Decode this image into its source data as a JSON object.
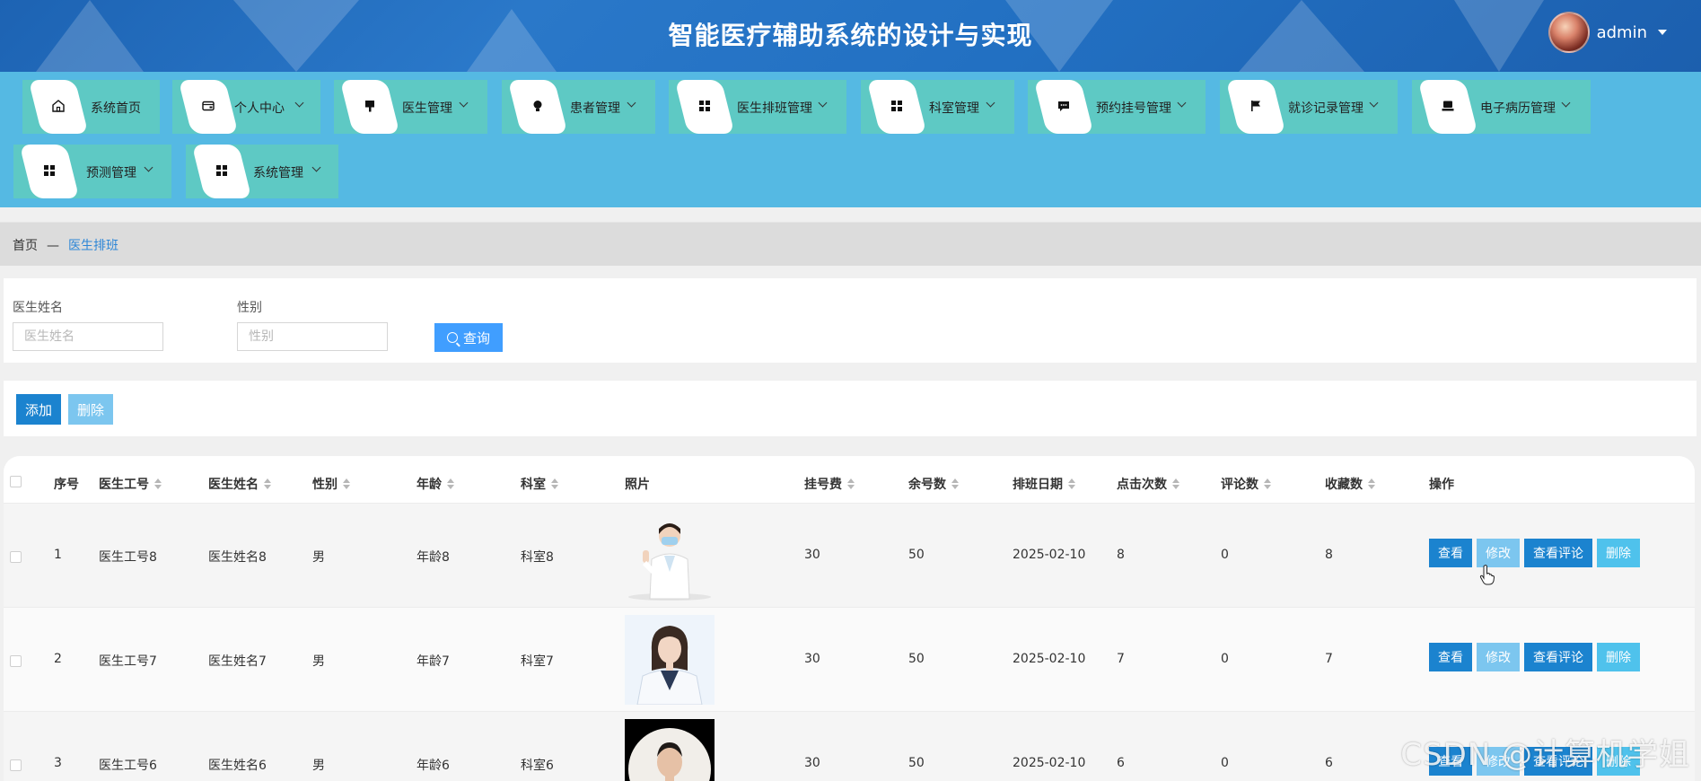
{
  "header": {
    "title": "智能医疗辅助系统的设计与实现",
    "username": "admin"
  },
  "nav": {
    "items": [
      {
        "label": "系统首页",
        "icon": "home-icon",
        "dropdown": false
      },
      {
        "label": "个人中心",
        "icon": "wallet-icon",
        "dropdown": true
      },
      {
        "label": "医生管理",
        "icon": "brush-icon",
        "dropdown": true
      },
      {
        "label": "患者管理",
        "icon": "bulb-icon",
        "dropdown": true
      },
      {
        "label": "医生排班管理",
        "icon": "grid-icon",
        "dropdown": true
      },
      {
        "label": "科室管理",
        "icon": "grid-icon",
        "dropdown": true
      },
      {
        "label": "预约挂号管理",
        "icon": "chat-icon",
        "dropdown": true
      },
      {
        "label": "就诊记录管理",
        "icon": "flag-icon",
        "dropdown": true
      },
      {
        "label": "电子病历管理",
        "icon": "monitor-icon",
        "dropdown": true
      },
      {
        "label": "预测管理",
        "icon": "grid-icon",
        "dropdown": true
      },
      {
        "label": "系统管理",
        "icon": "grid-icon",
        "dropdown": true
      }
    ]
  },
  "breadcrumb": {
    "home": "首页",
    "separator": "—",
    "current": "医生排班"
  },
  "search": {
    "name_label": "医生姓名",
    "name_placeholder": "医生姓名",
    "name_value": "",
    "gender_label": "性别",
    "gender_placeholder": "性别",
    "gender_value": "",
    "query_label": "查询"
  },
  "toolbar": {
    "add_label": "添加",
    "delete_label": "删除"
  },
  "table": {
    "headers": [
      "序号",
      "医生工号",
      "医生姓名",
      "性别",
      "年龄",
      "科室",
      "照片",
      "挂号费",
      "余号数",
      "排班日期",
      "点击次数",
      "评论数",
      "收藏数",
      "操作"
    ],
    "actions": {
      "view": "查看",
      "edit": "修改",
      "comments": "查看评论",
      "delete": "删除"
    },
    "rows": [
      {
        "index": "1",
        "doctor_id": "医生工号8",
        "name": "医生姓名8",
        "gender": "男",
        "age": "年龄8",
        "dept": "科室8",
        "fee": "30",
        "remaining": "50",
        "date": "2025-02-10",
        "clicks": "8",
        "comments": "0",
        "favorites": "8"
      },
      {
        "index": "2",
        "doctor_id": "医生工号7",
        "name": "医生姓名7",
        "gender": "男",
        "age": "年龄7",
        "dept": "科室7",
        "fee": "30",
        "remaining": "50",
        "date": "2025-02-10",
        "clicks": "7",
        "comments": "0",
        "favorites": "7"
      },
      {
        "index": "3",
        "doctor_id": "医生工号6",
        "name": "医生姓名6",
        "gender": "男",
        "age": "年龄6",
        "dept": "科室6",
        "fee": "30",
        "remaining": "50",
        "date": "2025-02-10",
        "clicks": "6",
        "comments": "0",
        "favorites": "6"
      }
    ]
  },
  "watermark": "CSDN @计算机学姐"
}
